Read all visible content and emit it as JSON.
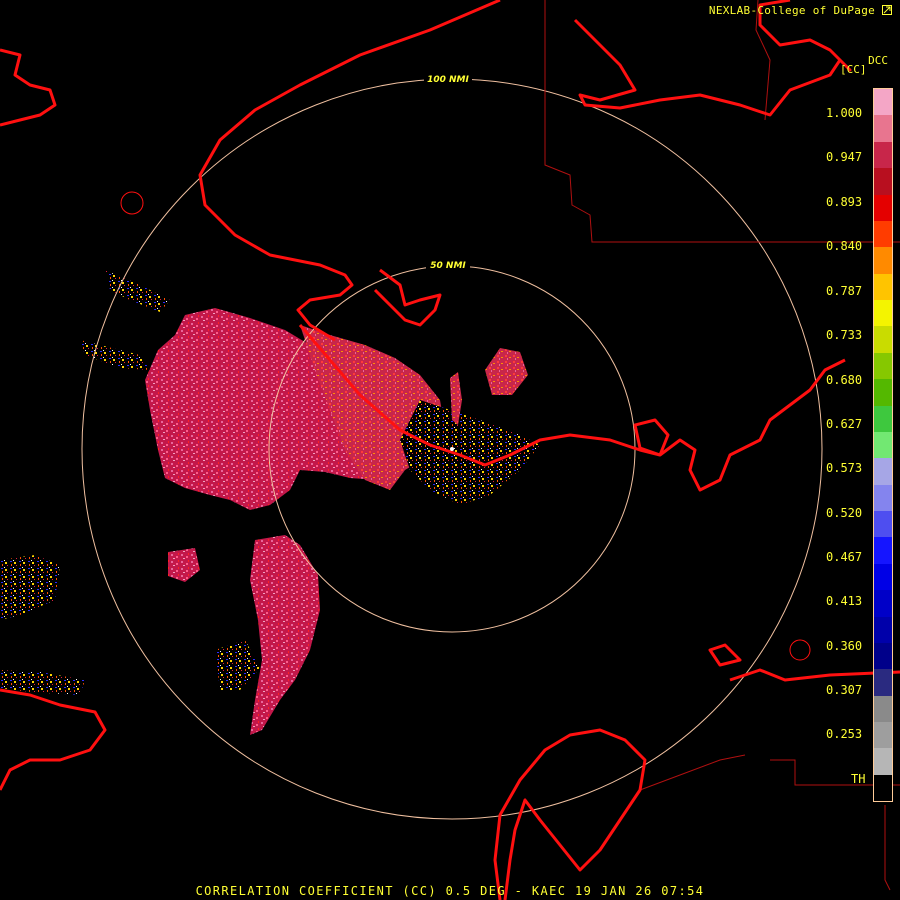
{
  "header": {
    "credit": "NEXLAB-College of DuPage",
    "logo_icon": "nexlab-corner-logo",
    "product": "DCC",
    "unit": "[CC]"
  },
  "range_rings": [
    {
      "label": "100 NMI"
    },
    {
      "label": "50 NMI"
    }
  ],
  "legend": {
    "ticks": [
      "1.000",
      "0.947",
      "0.893",
      "0.840",
      "0.787",
      "0.733",
      "0.680",
      "0.627",
      "0.573",
      "0.520",
      "0.467",
      "0.413",
      "0.360",
      "0.307",
      "0.253",
      "TH"
    ],
    "colors": [
      "#f4a6c6",
      "#e8758f",
      "#c8264a",
      "#b80f1f",
      "#e40000",
      "#ff3c00",
      "#ff8a00",
      "#ffc400",
      "#f4f400",
      "#c9dc00",
      "#86c800",
      "#54b800",
      "#3ec83e",
      "#72e872",
      "#a6a6e6",
      "#8484ee",
      "#4e4ef0",
      "#1515ff",
      "#0000e6",
      "#0000c8",
      "#0000aa",
      "#00008a",
      "#2a2a80",
      "#8a8a8a",
      "#9e9e9e",
      "#b6b6b6",
      "#000000"
    ]
  },
  "footer": {
    "text": "CORRELATION COEFFICIENT (CC) 0.5 DEG - KAEC 19 JAN 26 07:54"
  }
}
